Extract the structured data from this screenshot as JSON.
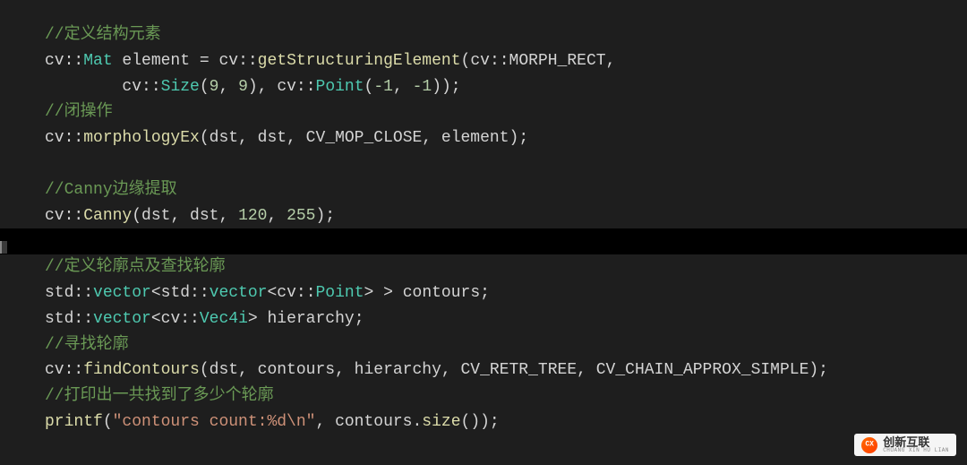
{
  "watermark": {
    "cn": "创新互联",
    "en": "CHUANG XIN HU LIAN"
  },
  "lines": [
    {
      "indent": 0,
      "segments": [
        {
          "t": "//定义结构元素",
          "c": "comment"
        }
      ]
    },
    {
      "indent": 0,
      "segments": [
        {
          "t": "cv",
          "c": "ident"
        },
        {
          "t": "::",
          "c": "punct"
        },
        {
          "t": "Mat",
          "c": "type"
        },
        {
          "t": " element ",
          "c": "ident"
        },
        {
          "t": "=",
          "c": "punct"
        },
        {
          "t": " cv",
          "c": "ident"
        },
        {
          "t": "::",
          "c": "punct"
        },
        {
          "t": "getStructuringElement",
          "c": "func"
        },
        {
          "t": "(",
          "c": "punct"
        },
        {
          "t": "cv",
          "c": "ident"
        },
        {
          "t": "::",
          "c": "punct"
        },
        {
          "t": "MORPH_RECT",
          "c": "enum"
        },
        {
          "t": ",",
          "c": "punct"
        }
      ]
    },
    {
      "indent": 2,
      "segments": [
        {
          "t": "cv",
          "c": "ident"
        },
        {
          "t": "::",
          "c": "punct"
        },
        {
          "t": "Size",
          "c": "type"
        },
        {
          "t": "(",
          "c": "punct"
        },
        {
          "t": "9",
          "c": "number"
        },
        {
          "t": ", ",
          "c": "punct"
        },
        {
          "t": "9",
          "c": "number"
        },
        {
          "t": "), ",
          "c": "punct"
        },
        {
          "t": "cv",
          "c": "ident"
        },
        {
          "t": "::",
          "c": "punct"
        },
        {
          "t": "Point",
          "c": "type"
        },
        {
          "t": "(",
          "c": "punct"
        },
        {
          "t": "-1",
          "c": "number"
        },
        {
          "t": ", ",
          "c": "punct"
        },
        {
          "t": "-1",
          "c": "number"
        },
        {
          "t": "));",
          "c": "punct"
        }
      ]
    },
    {
      "indent": 0,
      "segments": [
        {
          "t": "//闭操作",
          "c": "comment"
        }
      ]
    },
    {
      "indent": 0,
      "segments": [
        {
          "t": "cv",
          "c": "ident"
        },
        {
          "t": "::",
          "c": "punct"
        },
        {
          "t": "morphologyEx",
          "c": "func"
        },
        {
          "t": "(dst, dst, ",
          "c": "ident"
        },
        {
          "t": "CV_MOP_CLOSE",
          "c": "enum"
        },
        {
          "t": ", element);",
          "c": "ident"
        }
      ]
    },
    {
      "indent": 0,
      "segments": []
    },
    {
      "indent": 0,
      "segments": [
        {
          "t": "//Canny边缘提取",
          "c": "comment"
        }
      ]
    },
    {
      "indent": 0,
      "segments": [
        {
          "t": "cv",
          "c": "ident"
        },
        {
          "t": "::",
          "c": "punct"
        },
        {
          "t": "Canny",
          "c": "func"
        },
        {
          "t": "(dst, dst, ",
          "c": "ident"
        },
        {
          "t": "120",
          "c": "number"
        },
        {
          "t": ", ",
          "c": "punct"
        },
        {
          "t": "255",
          "c": "number"
        },
        {
          "t": ");",
          "c": "punct"
        }
      ]
    },
    {
      "indent": 0,
      "segments": [],
      "highlight": true
    },
    {
      "indent": 0,
      "segments": [
        {
          "t": "//定义轮廓点及查找轮廓",
          "c": "comment"
        }
      ]
    },
    {
      "indent": 0,
      "segments": [
        {
          "t": "std",
          "c": "ident"
        },
        {
          "t": "::",
          "c": "punct"
        },
        {
          "t": "vector",
          "c": "type"
        },
        {
          "t": "<",
          "c": "punct"
        },
        {
          "t": "std",
          "c": "ident"
        },
        {
          "t": "::",
          "c": "punct"
        },
        {
          "t": "vector",
          "c": "type"
        },
        {
          "t": "<",
          "c": "punct"
        },
        {
          "t": "cv",
          "c": "ident"
        },
        {
          "t": "::",
          "c": "punct"
        },
        {
          "t": "Point",
          "c": "type"
        },
        {
          "t": "> > contours;",
          "c": "ident"
        }
      ]
    },
    {
      "indent": 0,
      "segments": [
        {
          "t": "std",
          "c": "ident"
        },
        {
          "t": "::",
          "c": "punct"
        },
        {
          "t": "vector",
          "c": "type"
        },
        {
          "t": "<",
          "c": "punct"
        },
        {
          "t": "cv",
          "c": "ident"
        },
        {
          "t": "::",
          "c": "punct"
        },
        {
          "t": "Vec4i",
          "c": "type"
        },
        {
          "t": "> hierarchy;",
          "c": "ident"
        }
      ]
    },
    {
      "indent": 0,
      "segments": [
        {
          "t": "//寻找轮廓",
          "c": "comment"
        }
      ]
    },
    {
      "indent": 0,
      "segments": [
        {
          "t": "cv",
          "c": "ident"
        },
        {
          "t": "::",
          "c": "punct"
        },
        {
          "t": "findContours",
          "c": "func"
        },
        {
          "t": "(dst, contours, hierarchy, ",
          "c": "ident"
        },
        {
          "t": "CV_RETR_TREE",
          "c": "enum"
        },
        {
          "t": ", ",
          "c": "punct"
        },
        {
          "t": "CV_CHAIN_APPROX_SIMPLE",
          "c": "enum"
        },
        {
          "t": ");",
          "c": "punct"
        }
      ]
    },
    {
      "indent": 0,
      "segments": [
        {
          "t": "//打印出一共找到了多少个轮廓",
          "c": "comment"
        }
      ]
    },
    {
      "indent": 0,
      "segments": [
        {
          "t": "printf",
          "c": "func"
        },
        {
          "t": "(",
          "c": "punct"
        },
        {
          "t": "\"contours count:%d\\n\"",
          "c": "string"
        },
        {
          "t": ", contours.",
          "c": "ident"
        },
        {
          "t": "size",
          "c": "func"
        },
        {
          "t": "());",
          "c": "punct"
        }
      ]
    }
  ]
}
